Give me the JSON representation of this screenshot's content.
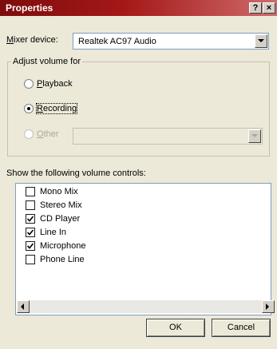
{
  "window": {
    "title": "Properties",
    "help_label": "?",
    "close_label": "×"
  },
  "mixer": {
    "label": "Mixer device:",
    "selected": "Realtek AC97 Audio"
  },
  "adjust_volume": {
    "legend": "Adjust volume for",
    "options": [
      {
        "label": "Playback",
        "checked": false,
        "enabled": true
      },
      {
        "label": "Recording",
        "checked": true,
        "enabled": true
      },
      {
        "label": "Other",
        "checked": false,
        "enabled": false
      }
    ],
    "other_selected": ""
  },
  "controls": {
    "label": "Show the following volume controls:",
    "items": [
      {
        "label": "Mono Mix",
        "checked": false
      },
      {
        "label": "Stereo Mix",
        "checked": false
      },
      {
        "label": "CD Player",
        "checked": true
      },
      {
        "label": "Line In",
        "checked": true
      },
      {
        "label": "Microphone",
        "checked": true
      },
      {
        "label": "Phone Line",
        "checked": false
      }
    ]
  },
  "buttons": {
    "ok": "OK",
    "cancel": "Cancel"
  },
  "colors": {
    "titlebar_start": "#7e0c0c",
    "titlebar_end": "#cf6b6b",
    "dialog_bg": "#ece9d8",
    "field_border": "#7f9db9"
  }
}
